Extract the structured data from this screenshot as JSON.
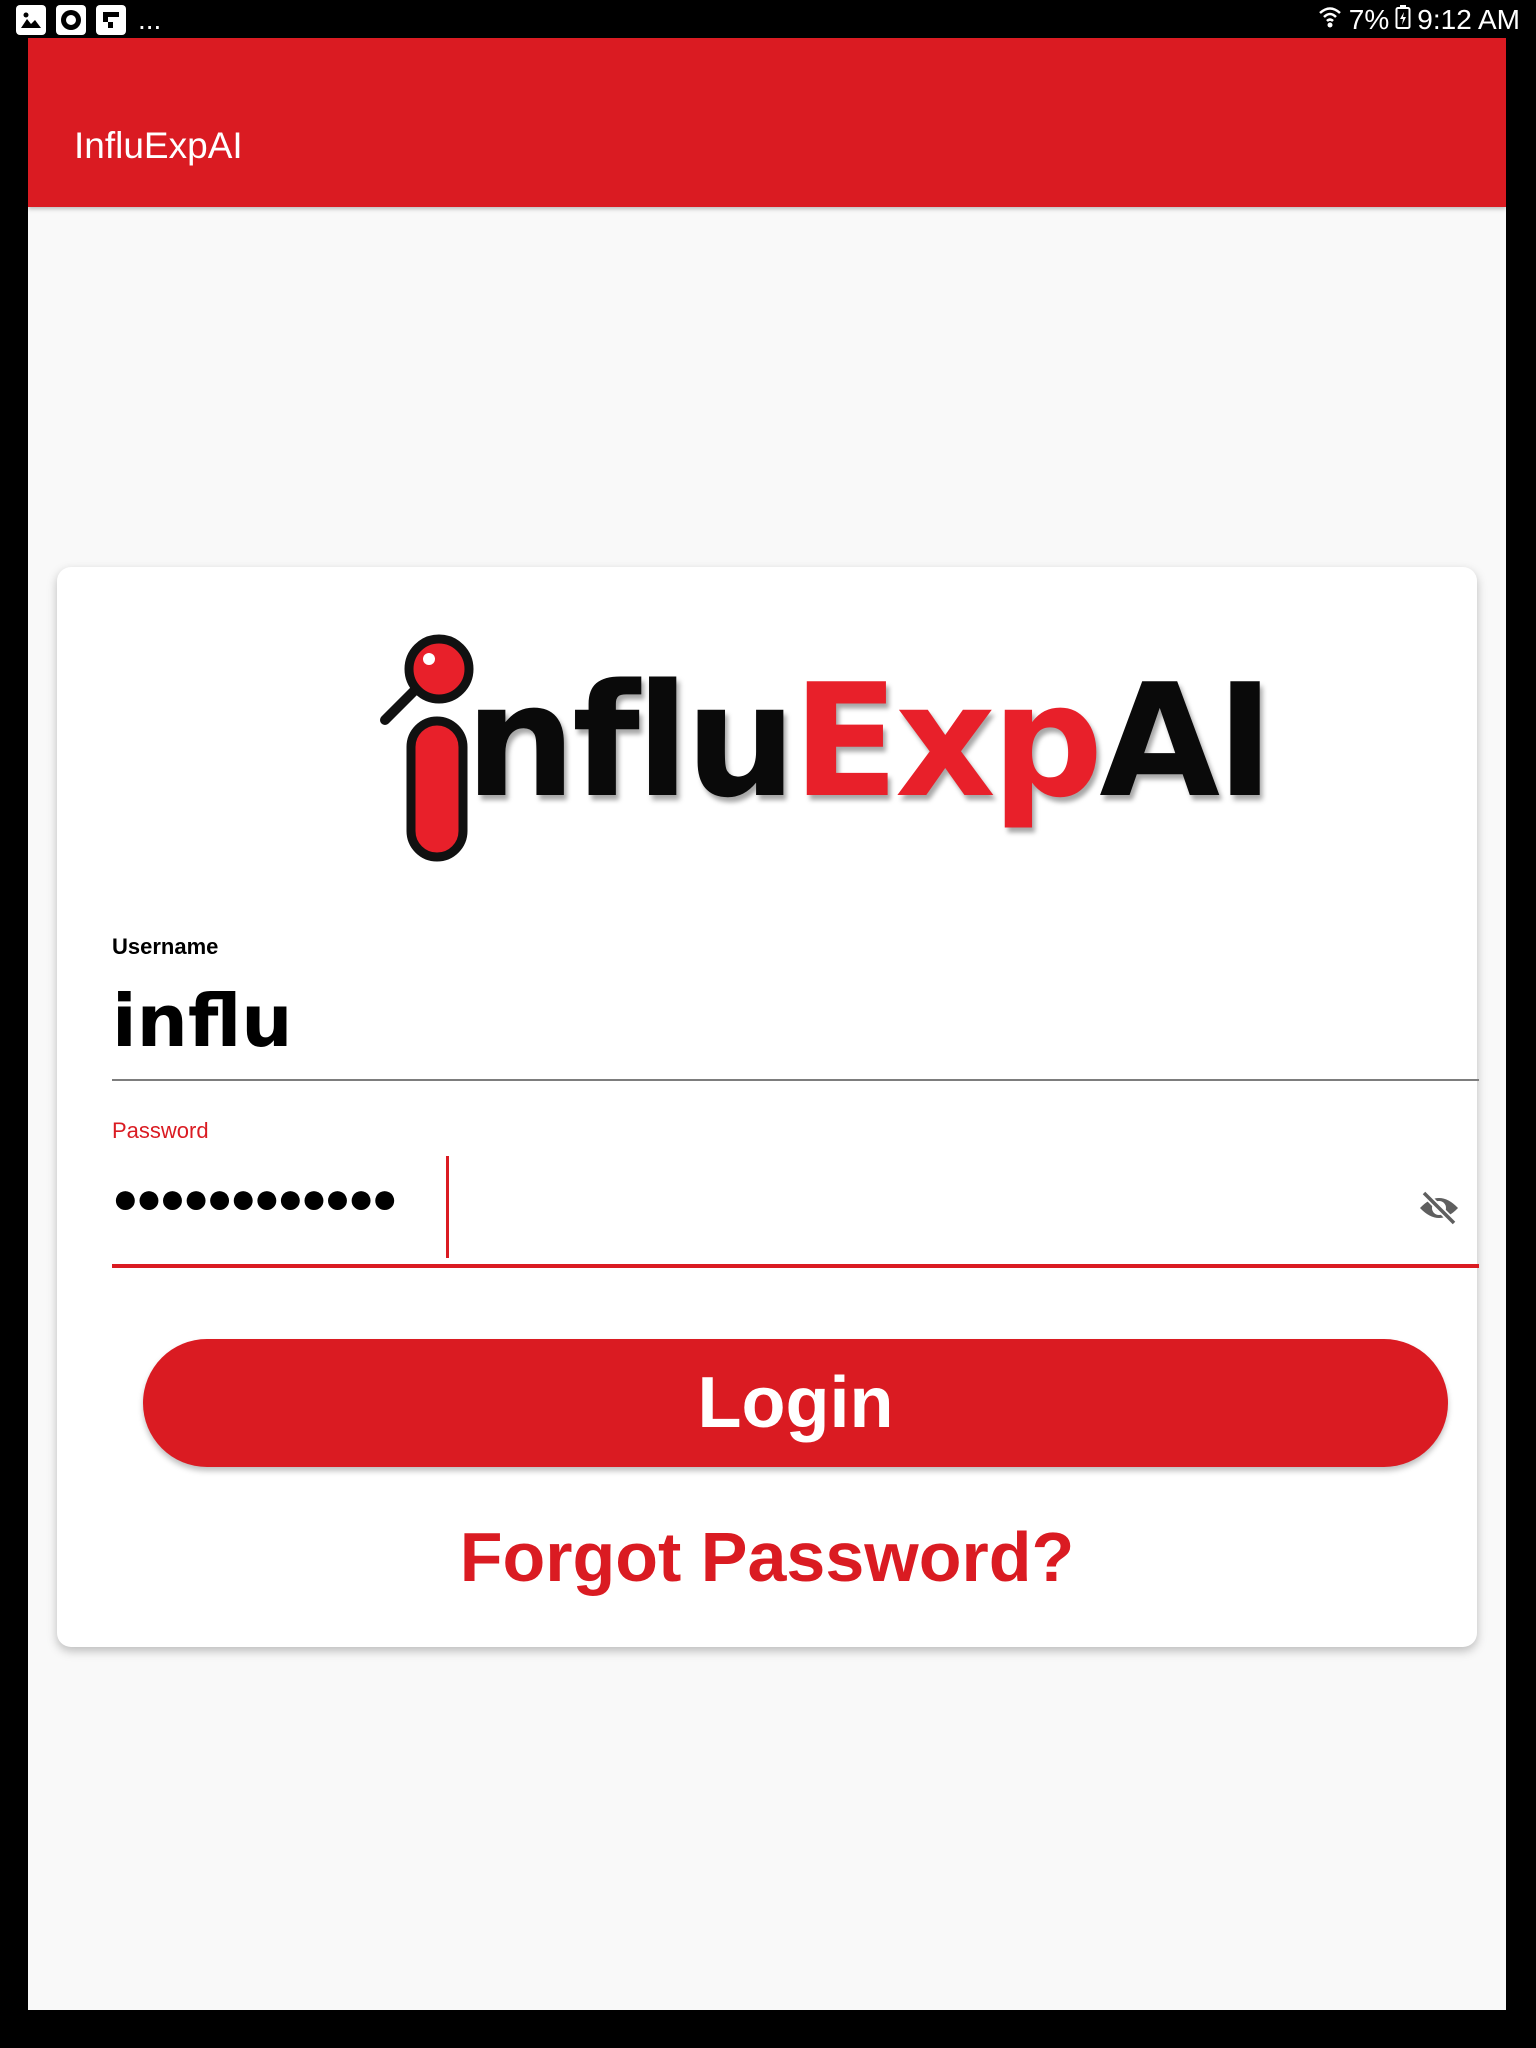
{
  "status_bar": {
    "notification_icons": [
      "image-icon",
      "app-icon",
      "flipboard-icon"
    ],
    "more_indicator": "...",
    "battery": "7%",
    "time": "9:12 AM"
  },
  "app_bar": {
    "title": "InfluExpAI"
  },
  "logo": {
    "text_dark_1": "nflu",
    "text_red": "Exp",
    "text_dark_2": "AI"
  },
  "form": {
    "username_label": "Username",
    "username_value": "influ",
    "password_label": "Password",
    "password_masked": "●●●●●●●●●●●●",
    "visibility_icon": "visibility-off-icon"
  },
  "actions": {
    "login_label": "Login",
    "forgot_label": "Forgot Password?"
  },
  "colors": {
    "brand_red": "#da1b22",
    "logo_red": "#e8202a",
    "background": "#f9f9f9"
  }
}
